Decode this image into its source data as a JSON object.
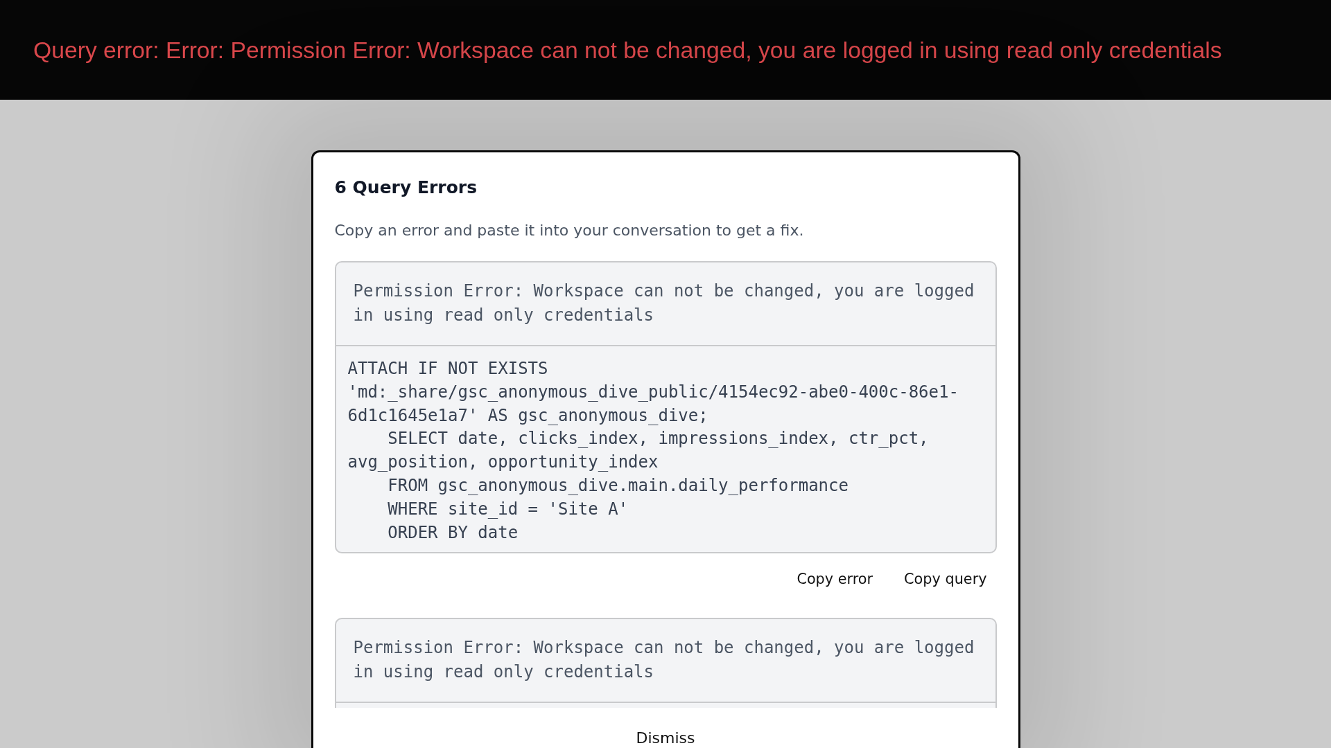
{
  "banner": {
    "text": "Query error: Error: Permission Error: Workspace can not be changed, you are logged in using read only credentials"
  },
  "dialog": {
    "title": "6 Query Errors",
    "description": "Copy an error and paste it into your conversation to get a fix.",
    "errors": [
      {
        "message": "Permission Error: Workspace can not be changed, you are logged in using read only credentials",
        "query": "ATTACH IF NOT EXISTS 'md:_share/gsc_anonymous_dive_public/4154ec92-abe0-400c-86e1-6d1c1645e1a7' AS gsc_anonymous_dive;\n    SELECT date, clicks_index, impressions_index, ctr_pct, avg_position, opportunity_index\n    FROM gsc_anonymous_dive.main.daily_performance\n    WHERE site_id = 'Site A'\n    ORDER BY date",
        "actions": [
          "Copy error",
          "Copy query"
        ]
      },
      {
        "message": "Permission Error: Workspace can not be changed, you are logged in using read only credentials"
      }
    ],
    "dismiss_button": "Dismiss"
  }
}
